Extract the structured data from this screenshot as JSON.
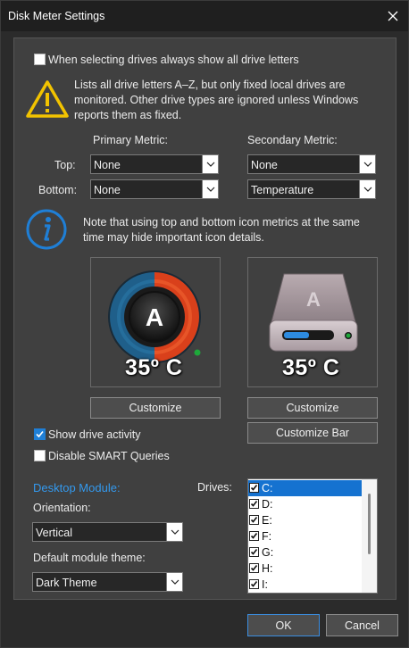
{
  "window": {
    "title": "Disk Meter Settings"
  },
  "options": {
    "show_all_letters": {
      "label": "When selecting drives always show all drive letters",
      "checked": false
    },
    "warning_text_1": "Lists all drive letters A–Z, but only fixed local drives are",
    "warning_text_2": "monitored. Other drive types are ignored unless Windows",
    "warning_text_3": "reports them as fixed."
  },
  "metrics": {
    "primary_header": "Primary Metric:",
    "secondary_header": "Secondary Metric:",
    "top_label": "Top:",
    "bottom_label": "Bottom:",
    "primary_top": "None",
    "primary_bottom": "None",
    "secondary_top": "None",
    "secondary_bottom": "Temperature"
  },
  "info": {
    "line_1": "Note that using top and bottom icon metrics at the same",
    "line_2": "time may hide important icon details."
  },
  "previews": {
    "primary": {
      "letter": "A",
      "temperature": "35º C"
    },
    "secondary": {
      "letter": "A",
      "temperature": "35º C"
    }
  },
  "buttons": {
    "customize_primary": "Customize",
    "customize_secondary": "Customize",
    "customize_bar": "Customize Bar",
    "ok": "OK",
    "cancel": "Cancel"
  },
  "checkboxes": {
    "show_activity": {
      "label": "Show drive activity",
      "checked": true
    },
    "disable_smart": {
      "label": "Disable SMART Queries",
      "checked": false
    }
  },
  "desktop_module": {
    "header": "Desktop Module:",
    "orientation_label": "Orientation:",
    "orientation_value": "Vertical",
    "theme_label": "Default module theme:",
    "theme_value": "Dark Theme"
  },
  "drives": {
    "label": "Drives:",
    "items": [
      {
        "letter": "C:",
        "checked": true,
        "selected": true
      },
      {
        "letter": "D:",
        "checked": true,
        "selected": false
      },
      {
        "letter": "E:",
        "checked": true,
        "selected": false
      },
      {
        "letter": "F:",
        "checked": true,
        "selected": false
      },
      {
        "letter": "G:",
        "checked": true,
        "selected": false
      },
      {
        "letter": "H:",
        "checked": true,
        "selected": false
      },
      {
        "letter": "I:",
        "checked": true,
        "selected": false
      }
    ]
  },
  "colors": {
    "accent": "#1f7fd6",
    "ring_blue": "#1f5f8a",
    "ring_orange": "#d9401b",
    "warning_yellow": "#f2c300"
  }
}
